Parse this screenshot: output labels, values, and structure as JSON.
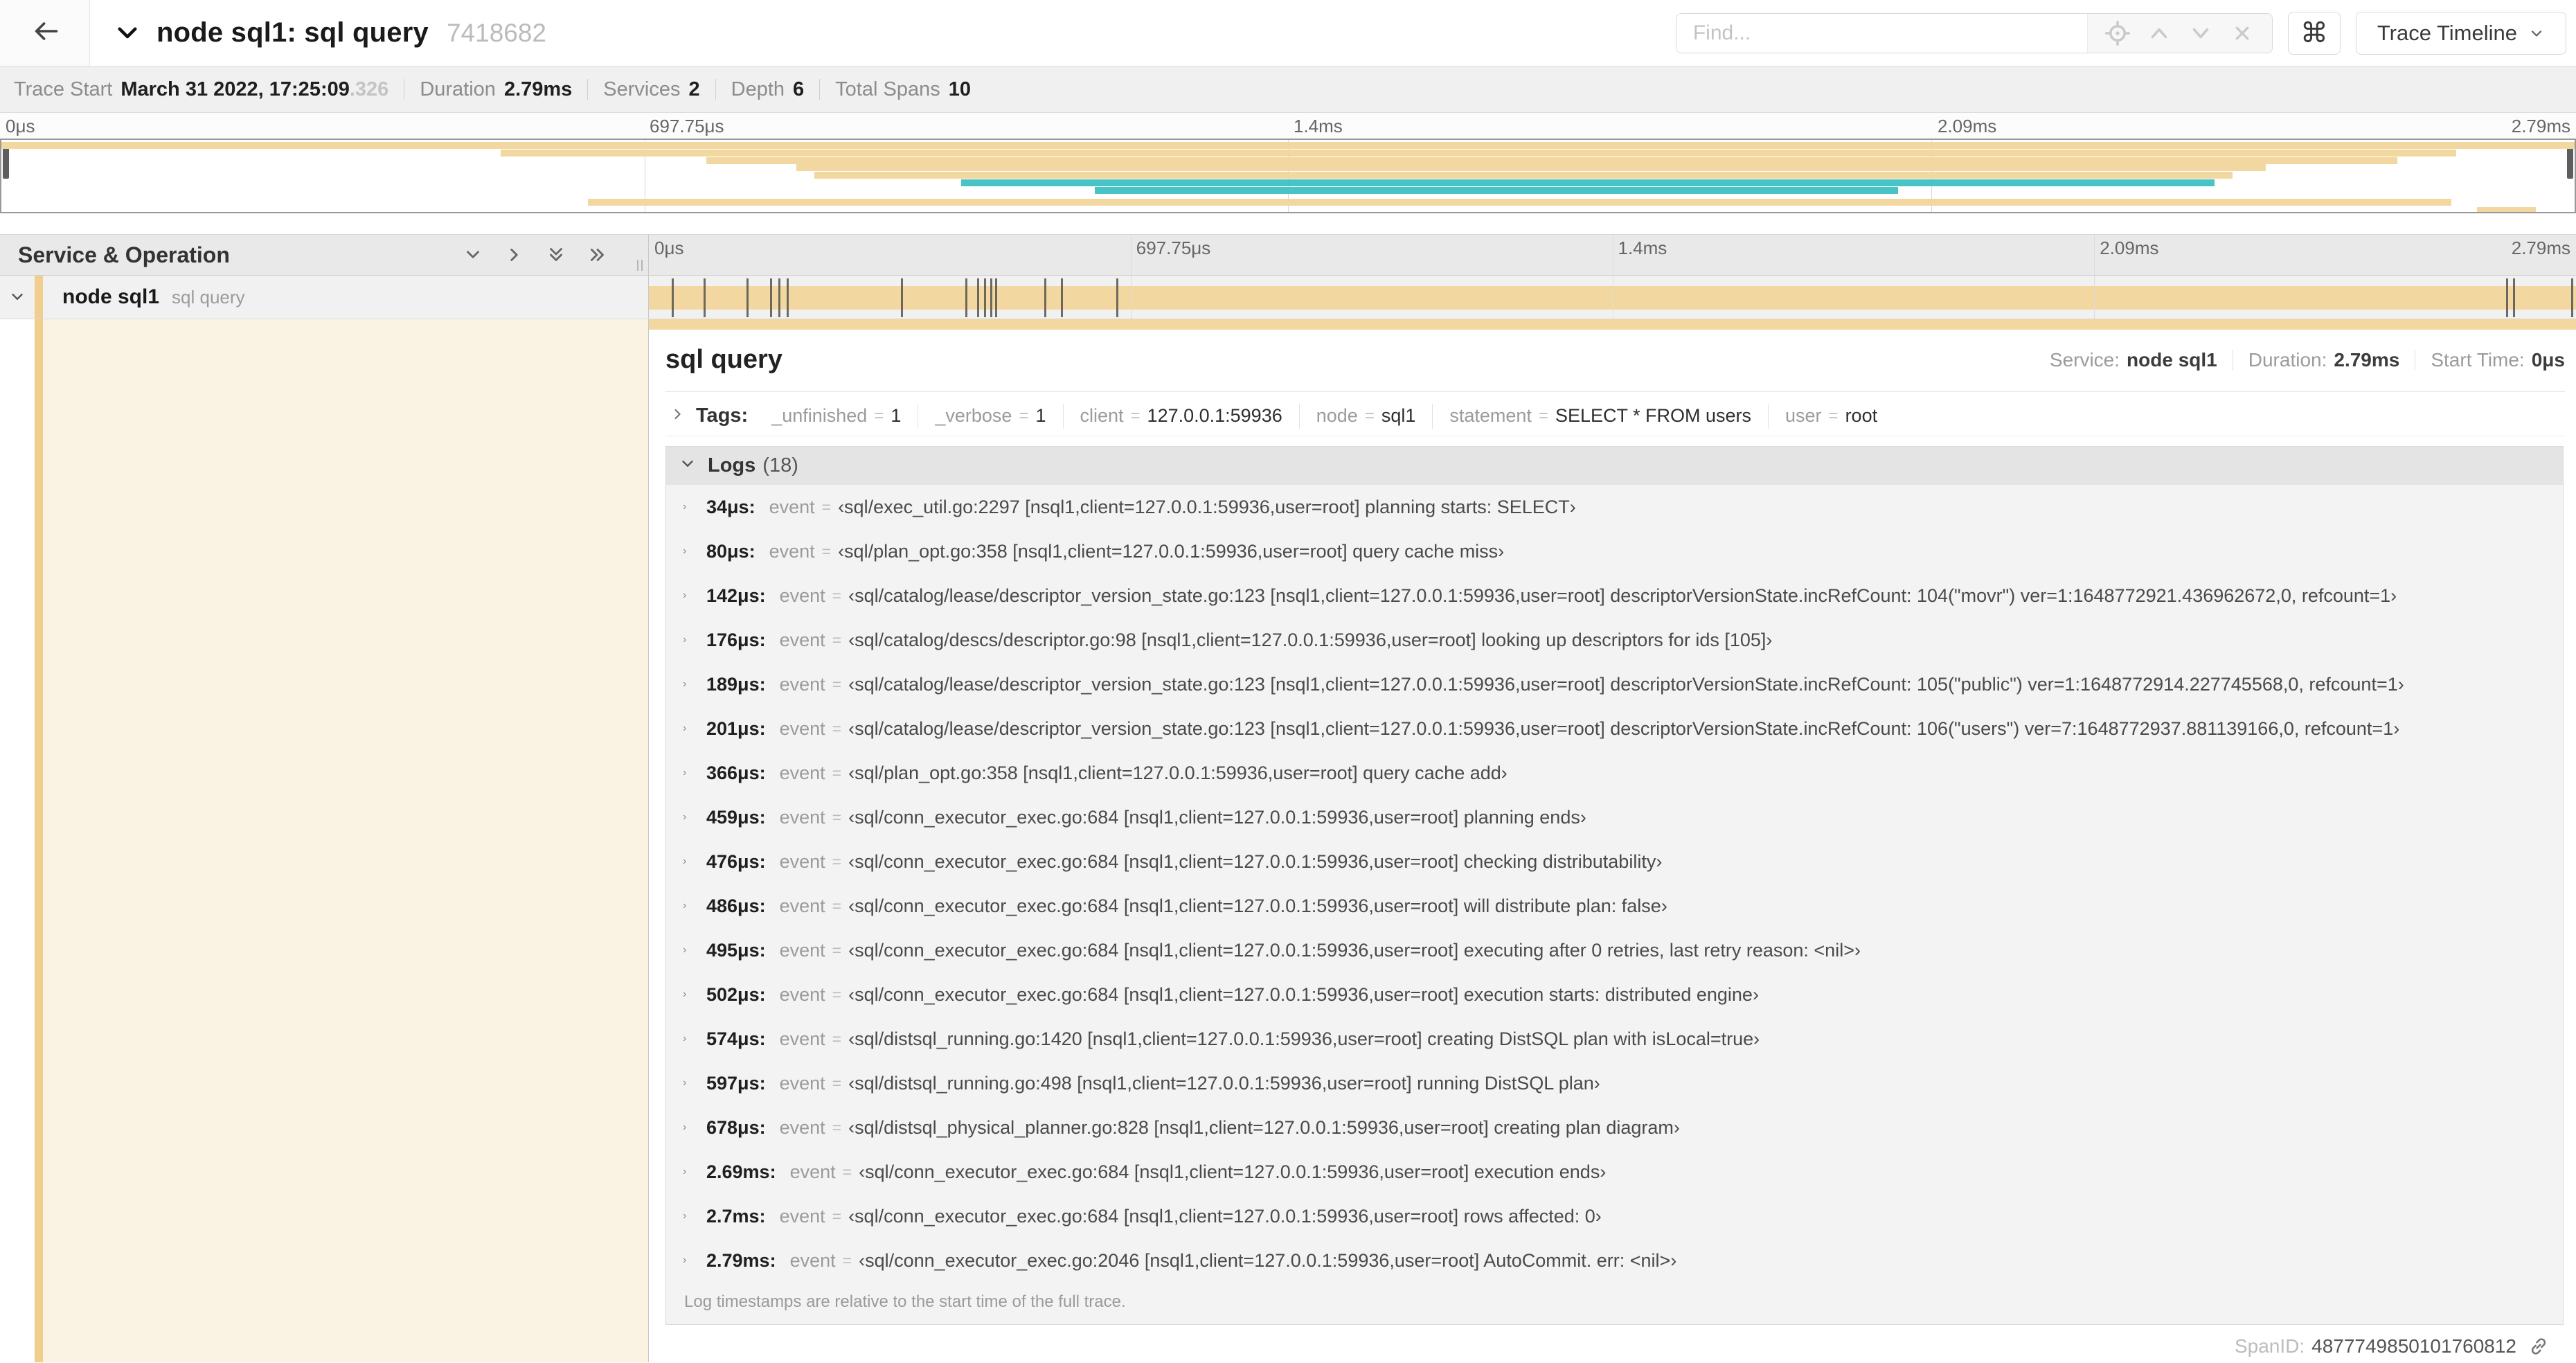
{
  "colors": {
    "tan": "#F2D8A0",
    "teal": "#49C4C6",
    "stripe": "#F0CE8D",
    "cream": "#FAF3E4",
    "marker": "#4A4A4A"
  },
  "header": {
    "title": "node sql1: sql query",
    "trace_id": "7418682",
    "find_placeholder": "Find...",
    "shortcut_label": "⌘",
    "view_button": "Trace Timeline"
  },
  "trace_info": [
    {
      "label": "Trace Start",
      "value": "March 31 2022, 17:25:09",
      "suffix": ".326"
    },
    {
      "label": "Duration",
      "value": "2.79ms"
    },
    {
      "label": "Services",
      "value": "2"
    },
    {
      "label": "Depth",
      "value": "6"
    },
    {
      "label": "Total Spans",
      "value": "10"
    }
  ],
  "timeline": {
    "left_header": "Service & Operation",
    "ticks": [
      "0μs",
      "697.75μs",
      "1.4ms",
      "2.09ms",
      "2.79ms"
    ],
    "row": {
      "service": "node sql1",
      "operation": "sql query"
    },
    "marker_fractions": [
      0.0122,
      0.0287,
      0.0509,
      0.0631,
      0.0677,
      0.072,
      0.1312,
      0.1645,
      0.1706,
      0.1742,
      0.1774,
      0.18,
      0.2057,
      0.214,
      0.243,
      0.9642,
      0.9677,
      0.998
    ]
  },
  "minimap": {
    "spans": [
      {
        "row": 0,
        "s": 0,
        "e": 1,
        "color": "tan"
      },
      {
        "row": 1,
        "s": 0.194,
        "e": 0.954,
        "color": "tan"
      },
      {
        "row": 2,
        "s": 0.274,
        "e": 0.931,
        "color": "tan"
      },
      {
        "row": 3,
        "s": 0.309,
        "e": 0.88,
        "color": "tan"
      },
      {
        "row": 4,
        "s": 0.316,
        "e": 0.867,
        "color": "tan"
      },
      {
        "row": 5,
        "s": 0.373,
        "e": 0.86,
        "color": "teal"
      },
      {
        "row": 6,
        "s": 0.425,
        "e": 0.737,
        "color": "teal"
      },
      {
        "row": 7.6,
        "s": 0.228,
        "e": 0.952,
        "color": "tan"
      },
      {
        "row": 8.7,
        "s": 0.962,
        "e": 0.985,
        "color": "tan"
      }
    ]
  },
  "detail": {
    "title": "sql query",
    "meta": [
      {
        "label": "Service:",
        "value": "node sql1"
      },
      {
        "label": "Duration:",
        "value": "2.79ms"
      },
      {
        "label": "Start Time:",
        "value": "0μs"
      }
    ],
    "tags_label": "Tags:",
    "tags": [
      {
        "key": "_unfinished",
        "value": "1"
      },
      {
        "key": "_verbose",
        "value": "1"
      },
      {
        "key": "client",
        "value": "127.0.0.1:59936"
      },
      {
        "key": "node",
        "value": "sql1"
      },
      {
        "key": "statement",
        "value": "SELECT * FROM users"
      },
      {
        "key": "user",
        "value": "root"
      }
    ],
    "logs_label": "Logs",
    "logs_count": "(18)",
    "logs": [
      {
        "time": "34μs:",
        "field": "event",
        "value": "‹sql/exec_util.go:2297 [nsql1,client=127.0.0.1:59936,user=root] planning starts: SELECT›"
      },
      {
        "time": "80μs:",
        "field": "event",
        "value": "‹sql/plan_opt.go:358 [nsql1,client=127.0.0.1:59936,user=root] query cache miss›"
      },
      {
        "time": "142μs:",
        "field": "event",
        "value": "‹sql/catalog/lease/descriptor_version_state.go:123 [nsql1,client=127.0.0.1:59936,user=root] descriptorVersionState.incRefCount: 104(\"movr\") ver=1:1648772921.436962672,0, refcount=1›"
      },
      {
        "time": "176μs:",
        "field": "event",
        "value": "‹sql/catalog/descs/descriptor.go:98 [nsql1,client=127.0.0.1:59936,user=root] looking up descriptors for ids [105]›"
      },
      {
        "time": "189μs:",
        "field": "event",
        "value": "‹sql/catalog/lease/descriptor_version_state.go:123 [nsql1,client=127.0.0.1:59936,user=root] descriptorVersionState.incRefCount: 105(\"public\") ver=1:1648772914.227745568,0, refcount=1›"
      },
      {
        "time": "201μs:",
        "field": "event",
        "value": "‹sql/catalog/lease/descriptor_version_state.go:123 [nsql1,client=127.0.0.1:59936,user=root] descriptorVersionState.incRefCount: 106(\"users\") ver=7:1648772937.881139166,0, refcount=1›"
      },
      {
        "time": "366μs:",
        "field": "event",
        "value": "‹sql/plan_opt.go:358 [nsql1,client=127.0.0.1:59936,user=root] query cache add›"
      },
      {
        "time": "459μs:",
        "field": "event",
        "value": "‹sql/conn_executor_exec.go:684 [nsql1,client=127.0.0.1:59936,user=root] planning ends›"
      },
      {
        "time": "476μs:",
        "field": "event",
        "value": "‹sql/conn_executor_exec.go:684 [nsql1,client=127.0.0.1:59936,user=root] checking distributability›"
      },
      {
        "time": "486μs:",
        "field": "event",
        "value": "‹sql/conn_executor_exec.go:684 [nsql1,client=127.0.0.1:59936,user=root] will distribute plan: false›"
      },
      {
        "time": "495μs:",
        "field": "event",
        "value": "‹sql/conn_executor_exec.go:684 [nsql1,client=127.0.0.1:59936,user=root] executing after 0 retries, last retry reason: <nil>›"
      },
      {
        "time": "502μs:",
        "field": "event",
        "value": "‹sql/conn_executor_exec.go:684 [nsql1,client=127.0.0.1:59936,user=root] execution starts: distributed engine›"
      },
      {
        "time": "574μs:",
        "field": "event",
        "value": "‹sql/distsql_running.go:1420 [nsql1,client=127.0.0.1:59936,user=root] creating DistSQL plan with isLocal=true›"
      },
      {
        "time": "597μs:",
        "field": "event",
        "value": "‹sql/distsql_running.go:498 [nsql1,client=127.0.0.1:59936,user=root] running DistSQL plan›"
      },
      {
        "time": "678μs:",
        "field": "event",
        "value": "‹sql/distsql_physical_planner.go:828 [nsql1,client=127.0.0.1:59936,user=root] creating plan diagram›"
      },
      {
        "time": "2.69ms:",
        "field": "event",
        "value": "‹sql/conn_executor_exec.go:684 [nsql1,client=127.0.0.1:59936,user=root] execution ends›"
      },
      {
        "time": "2.7ms:",
        "field": "event",
        "value": "‹sql/conn_executor_exec.go:684 [nsql1,client=127.0.0.1:59936,user=root] rows affected: 0›"
      },
      {
        "time": "2.79ms:",
        "field": "event",
        "value": "‹sql/conn_executor_exec.go:2046 [nsql1,client=127.0.0.1:59936,user=root] AutoCommit. err: <nil>›"
      }
    ],
    "note": "Log timestamps are relative to the start time of the full trace.",
    "spanid_label": "SpanID:",
    "spanid": "4877749850101760812"
  },
  "icons": {
    "chevron_right": "›",
    "chevron_down": "∨"
  }
}
